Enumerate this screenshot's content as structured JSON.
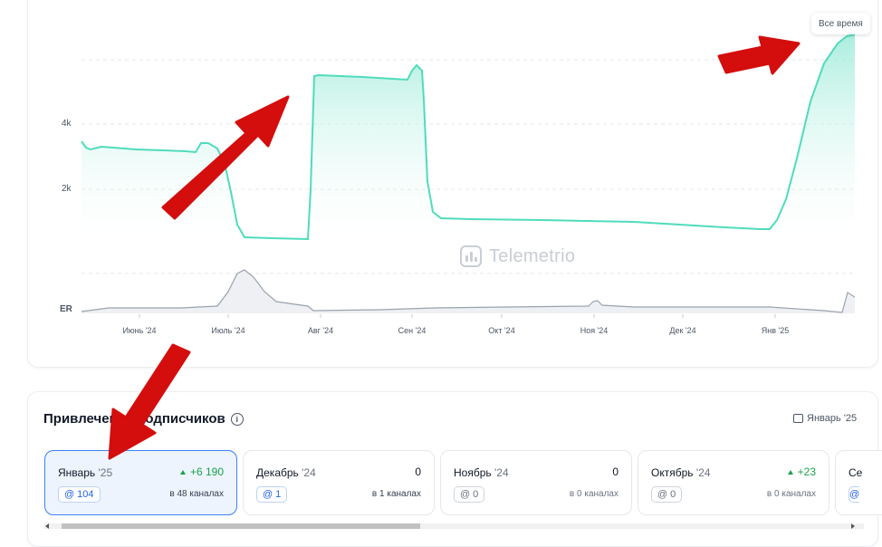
{
  "chart": {
    "range_label": "Все время",
    "watermark": "Telemetrio",
    "y_ticks": [
      "4k",
      "2k"
    ],
    "er_label": "ER",
    "x_ticks": [
      "Июнь '24",
      "Июль '24",
      "Авг '24",
      "Сен '24",
      "Окт '24",
      "Ноя '24",
      "Дек '24",
      "Янв '25"
    ],
    "line_color": "#4fdcbb",
    "fill_color": "#b9f0e2",
    "er_color": "#9aa3ae"
  },
  "chart_data": {
    "type": "area",
    "x": [
      "Июнь '24",
      "Июль '24",
      "Авг '24",
      "Сен '24",
      "Окт '24",
      "Ноя '24",
      "Дек '24",
      "Янв '25"
    ],
    "y_ticks": [
      "2k",
      "4k"
    ],
    "series": [
      {
        "values": [
          3200,
          1000,
          5400,
          1150,
          1100,
          1100,
          950,
          5800
        ]
      }
    ]
  },
  "attraction": {
    "title": "Привлечение подписчиков",
    "month_filter": "Январь '25",
    "months": [
      {
        "name": "Январь",
        "year": " '25",
        "delta": "+6 190",
        "positive": true,
        "badge": "104",
        "channels": "в 48 каналах",
        "active": true
      },
      {
        "name": "Декабрь",
        "year": " '24",
        "delta": "0",
        "positive": false,
        "badge": "1",
        "channels": "в 1 каналах",
        "active": false
      },
      {
        "name": "Ноябрь",
        "year": " '24",
        "delta": "0",
        "positive": false,
        "badge": "0",
        "channels": "в 0 каналах",
        "active": false
      },
      {
        "name": "Октябрь",
        "year": " '24",
        "delta": "+23",
        "positive": true,
        "badge": "0",
        "channels": "в 0 каналах",
        "active": false
      },
      {
        "name": "Се",
        "year": "",
        "delta": "",
        "positive": false,
        "badge": "",
        "channels": "",
        "active": false
      }
    ]
  },
  "annotations": {
    "arrow_color": "#d40d0d"
  }
}
